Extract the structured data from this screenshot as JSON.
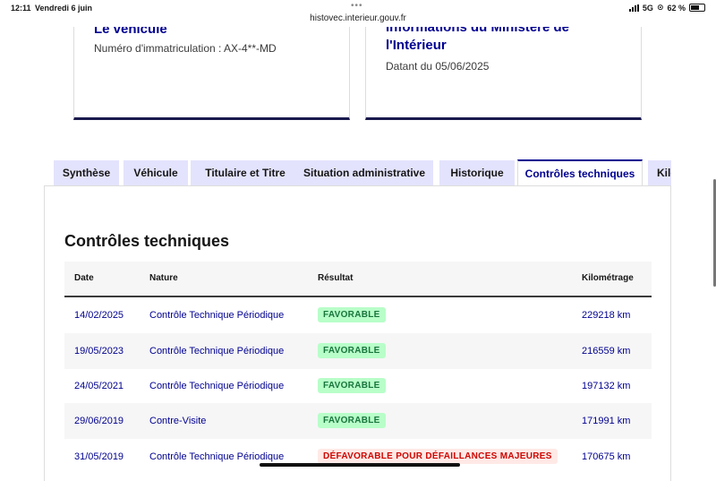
{
  "status_bar": {
    "time": "12:11",
    "date": "Vendredi 6 juin",
    "url": "histovec.interieur.gouv.fr",
    "network": "5G",
    "battery": "62 %"
  },
  "cards": [
    {
      "title": "Le véhicule",
      "subtitle": "Numéro d'immatriculation : AX-4**-MD"
    },
    {
      "title_line1": "Informations du Ministère de",
      "title_line2": "l'Intérieur",
      "subtitle": "Datant du 05/06/2025"
    }
  ],
  "tabs": [
    "Synthèse",
    "Véhicule",
    "Titulaire et Titre",
    "Situation administrative",
    "Historique",
    "Contrôles techniques",
    "Kilométrage"
  ],
  "active_tab": "Contrôles techniques",
  "section_title": "Contrôles techniques",
  "table": {
    "headers": [
      "Date",
      "Nature",
      "Résultat",
      "Kilométrage"
    ],
    "rows": [
      {
        "date": "14/02/2025",
        "nature": "Contrôle Technique Périodique",
        "result": "FAVORABLE",
        "km": "229218 km"
      },
      {
        "date": "19/05/2023",
        "nature": "Contrôle Technique Périodique",
        "result": "FAVORABLE",
        "km": "216559 km"
      },
      {
        "date": "24/05/2021",
        "nature": "Contrôle Technique Périodique",
        "result": "FAVORABLE",
        "km": "197132 km"
      },
      {
        "date": "29/06/2019",
        "nature": "Contre-Visite",
        "result": "FAVORABLE",
        "km": "171991 km"
      },
      {
        "date": "31/05/2019",
        "nature": "Contrôle Technique Périodique",
        "result": "DÉFAVORABLE POUR DÉFAILLANCES MAJEURES",
        "km": "170675 km"
      }
    ]
  },
  "colors": {
    "primary": "#000091",
    "tab_bg": "#e3e3fd",
    "favorable_bg": "#b8fec9",
    "favorable_text": "#18753c",
    "defavorable_bg": "#ffe9e6",
    "defavorable_text": "#ce0500"
  }
}
